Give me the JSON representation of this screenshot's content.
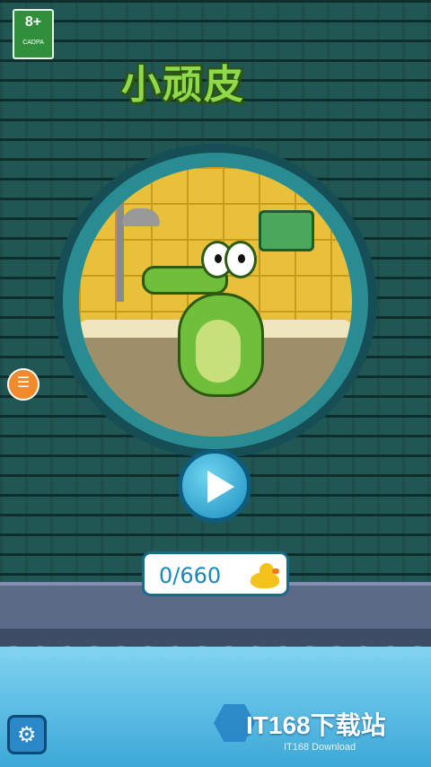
{
  "rating": {
    "age": "8+",
    "org": "CADPA"
  },
  "game": {
    "title": "小顽皮"
  },
  "score": {
    "value": "0/660",
    "item_icon": "rubber-duck-icon"
  },
  "buttons": {
    "play_icon": "play-icon",
    "menu_icon": "menu-icon",
    "settings_icon": "gear-icon"
  },
  "watermark": {
    "brand": "IT168下载站",
    "sub": "IT168 Download"
  },
  "colors": {
    "wall": "#1f6a6a",
    "water": "#5ec1e6",
    "play": "#1c8fc0",
    "title": "#8fd94a"
  }
}
